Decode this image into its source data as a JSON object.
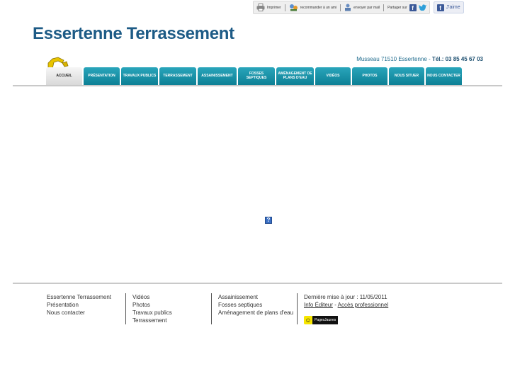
{
  "topbar": {
    "print_label": "Imprimer",
    "recommend_label": "recommander à un ami",
    "email_label": "envoyer par mail",
    "share_label": "Partager sur",
    "like_label": "J'aime"
  },
  "site": {
    "title": "Essertenne Terrassement",
    "address": "Musseau 71510 Essertenne -",
    "tel": "Tél.: 03 85 45 67 03"
  },
  "nav": {
    "items": [
      {
        "label": "ACCUEIL"
      },
      {
        "label": "PRÉSENTATION"
      },
      {
        "label": "TRAVAUX PUBLICS"
      },
      {
        "label": "TERRASSEMENT"
      },
      {
        "label": "ASSAINISSEMENT"
      },
      {
        "label": "FOSSES SEPTIQUES"
      },
      {
        "label": "AMÉNAGEMENT DE PLANS D'EAU"
      },
      {
        "label": "VIDÉOS"
      },
      {
        "label": "PHOTOS"
      },
      {
        "label": "NOUS SITUER"
      },
      {
        "label": "NOUS CONTACTER"
      }
    ]
  },
  "plugin": {
    "glyph": "?"
  },
  "footer": {
    "col1": [
      "Essertenne Terrassement",
      "Présentation",
      "Nous contacter"
    ],
    "col2": [
      "Vidéos",
      "Photos",
      "Travaux publics",
      "Terrassement"
    ],
    "col3": [
      "Assainissement",
      "Fosses septiques",
      "Aménagement de plans d'eau"
    ],
    "updated": "Dernière mise à jour : 11/05/2011",
    "info_editeur": "Info Éditeur",
    "separator": "-",
    "acces_pro": "Accès professionnel",
    "pj_label": "PagesJaunes"
  },
  "colors": {
    "brand_title": "#1d5b86",
    "nav_teal": "#1797ad",
    "divider": "#c9c9c9"
  }
}
